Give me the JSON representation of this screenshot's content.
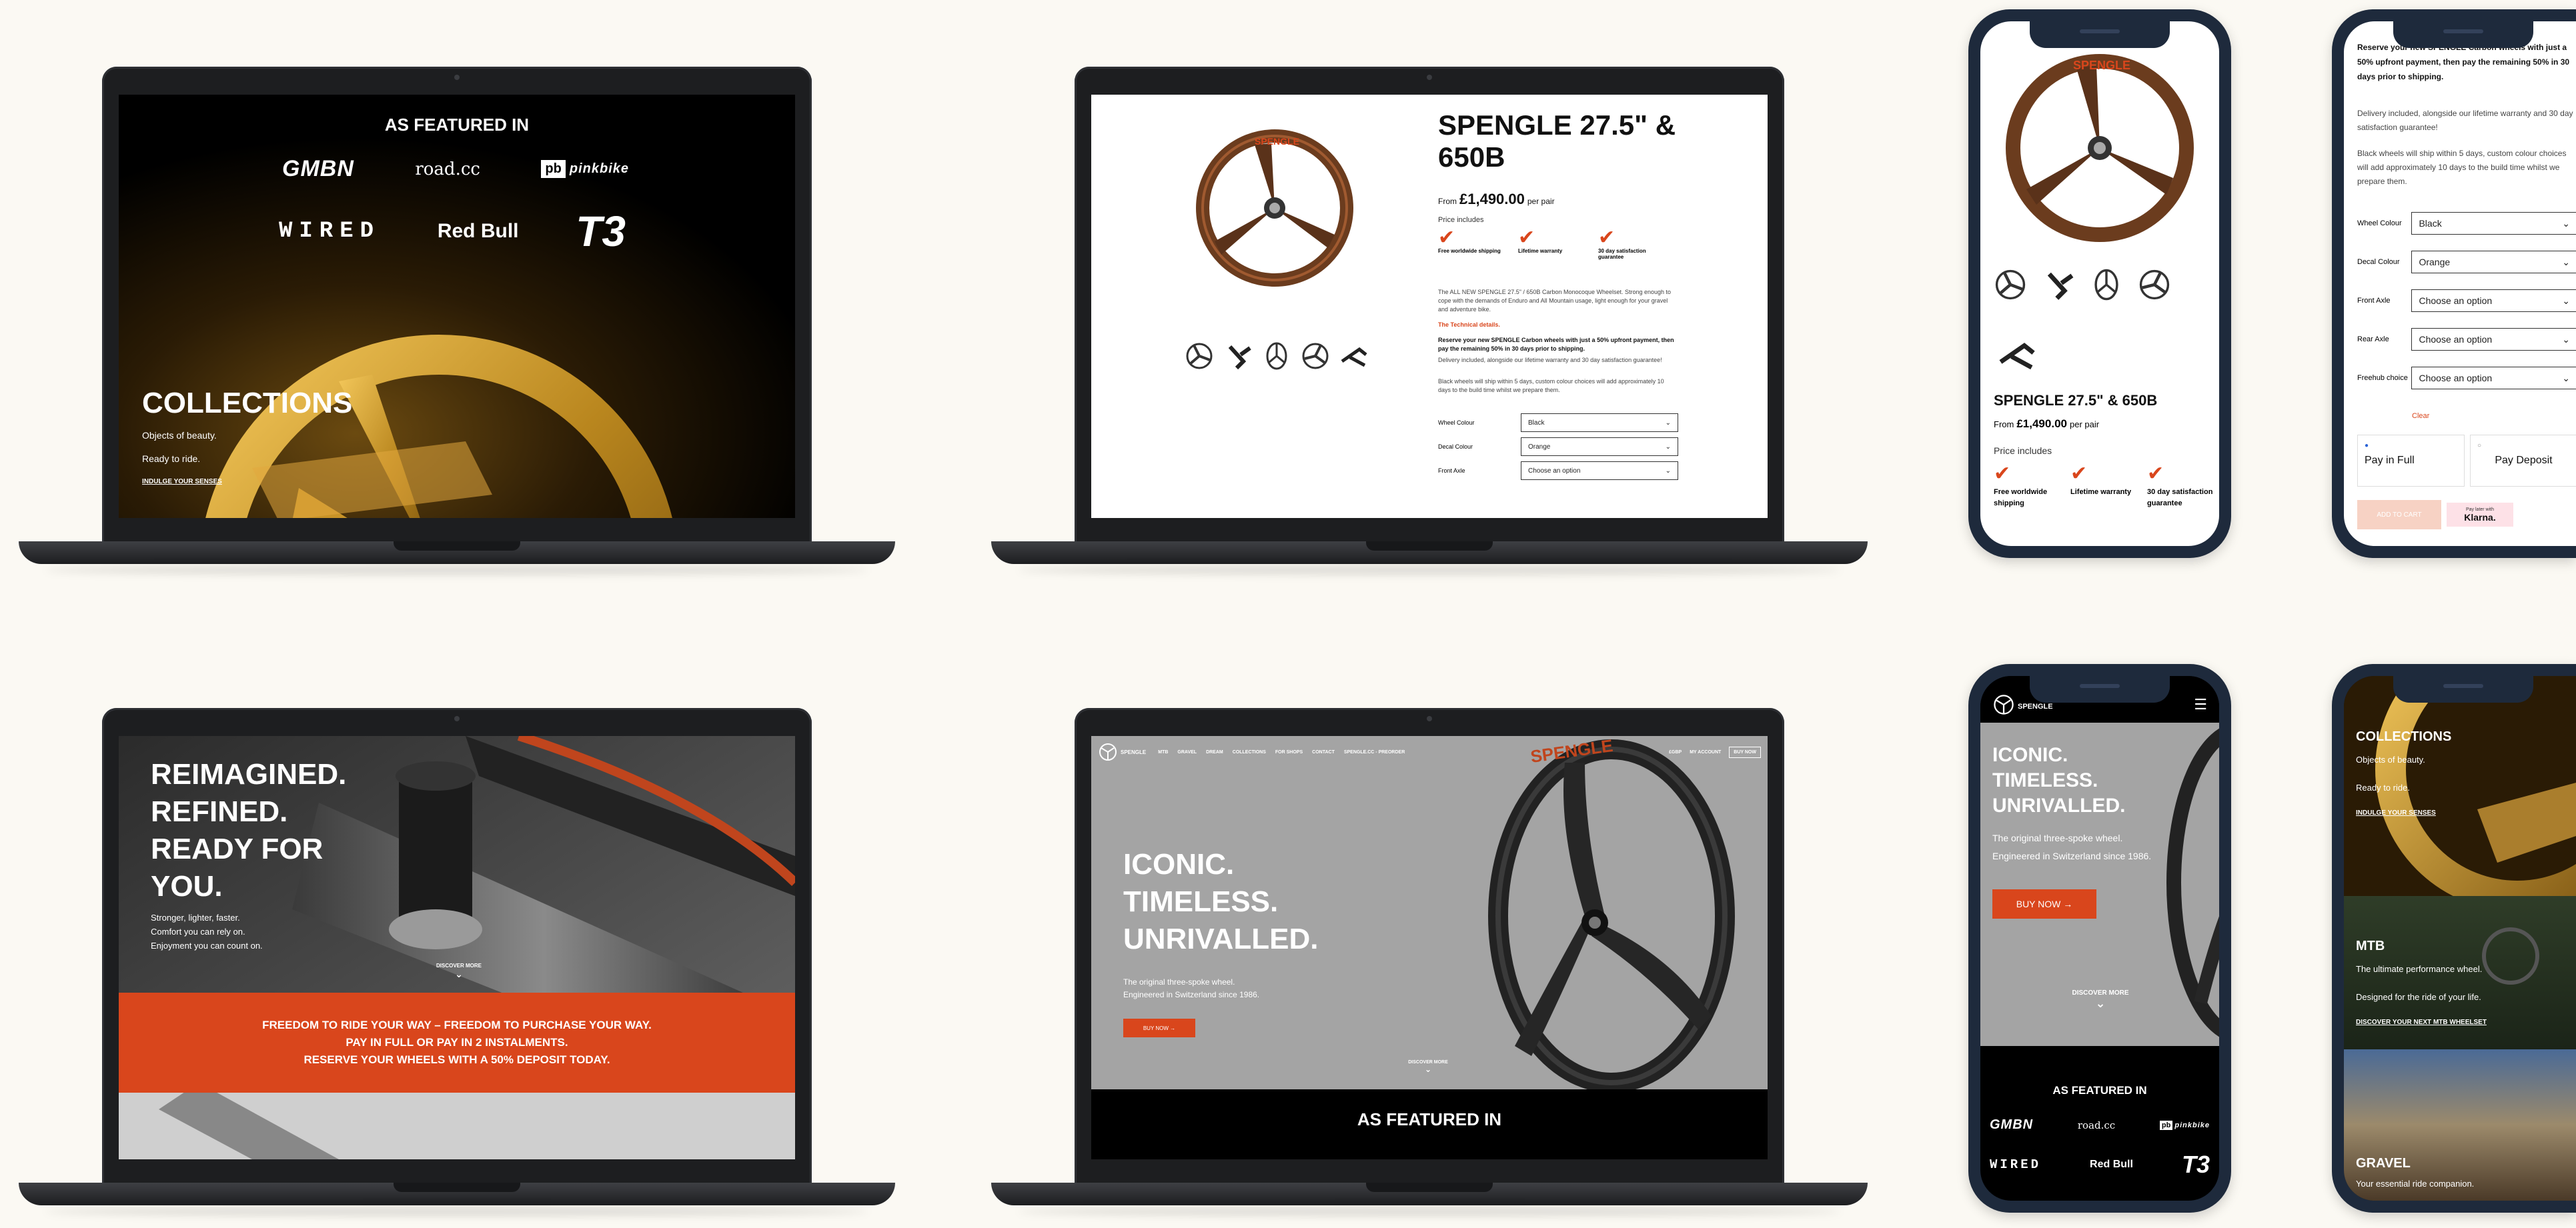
{
  "brand": "SPENGLE",
  "accent_color": "#d9461c",
  "featured": {
    "heading": "AS FEATURED IN",
    "logos": [
      "GMBN",
      "road.cc",
      "pinkbike",
      "WIRED",
      "Red Bull",
      "T3"
    ]
  },
  "collections": {
    "title": "COLLECTIONS",
    "line1": "Objects of beauty.",
    "line2": "Ready to ride.",
    "cta": "INDULGE YOUR SENSES"
  },
  "product": {
    "title": "SPENGLE 27.5\" & 650B",
    "title_mobile": "SPENGLE 27.5\" & 650B",
    "price_from": "From",
    "price": "£1,490.00",
    "price_suffix": "per pair",
    "price_includes": "Price includes",
    "features": [
      "Free worldwide shipping",
      "Lifetime warranty",
      "30 day satisfaction guarantee"
    ],
    "description": "The ALL NEW SPENGLE 27.5\" / 650B Carbon Monocoque Wheelset. Strong enough to cope with the demands of Enduro and All Mountain usage, light enough for your gravel and adventure bike.",
    "technical_link": "The Technical details.",
    "reserve_text": "Reserve your new SPENGLE Carbon wheels with just a 50% upfront payment, then pay the remaining 50% in 30 days prior to shipping.",
    "delivery_text": "Delivery included, alongside our lifetime warranty and 30 day satisfaction guarantee!",
    "black_text": "Black wheels will ship within 5 days, custom colour choices will add approximately 10 days to the build time whilst we prepare them.",
    "options": [
      {
        "label": "Wheel Colour",
        "value": "Black"
      },
      {
        "label": "Decal Colour",
        "value": "Orange"
      },
      {
        "label": "Front Axle",
        "value": "Choose an option"
      },
      {
        "label": "Rear Axle",
        "value": "Choose an option"
      },
      {
        "label": "Freehub choice",
        "value": "Choose an option"
      }
    ],
    "clear": "Clear",
    "pay_full": "Pay in Full",
    "pay_deposit": "Pay Deposit",
    "add_to_cart": "ADD TO CART",
    "klarna_label": "Pay later with",
    "klarna": "Klarna."
  },
  "promo": {
    "headline1": "REIMAGINED.",
    "headline2": "REFINED.",
    "headline3": "READY FOR",
    "headline4": "YOU.",
    "sub1": "Stronger, lighter, faster.",
    "sub2": "Comfort you can rely on.",
    "sub3": "Enjoyment you can count on.",
    "discover": "DISCOVER MORE",
    "banner1": "FREEDOM TO RIDE YOUR WAY – FREEDOM TO PURCHASE YOUR WAY.",
    "banner2": "PAY IN FULL OR PAY IN 2 INSTALMENTS.",
    "banner3": "RESERVE YOUR WHEELS WITH A 50% DEPOSIT TODAY."
  },
  "home": {
    "nav": [
      "MTB",
      "GRAVEL",
      "DREAM",
      "COLLECTIONS",
      "FOR SHOPS",
      "CONTACT",
      "SPENGLE.CC - PREORDER"
    ],
    "nav_right": [
      "£GBP",
      "MY ACCOUNT"
    ],
    "cart": "BUY NOW",
    "headline1": "ICONIC.",
    "headline2": "TIMELESS.",
    "headline3": "UNRIVALLED.",
    "sub1": "The original three-spoke wheel.",
    "sub2": "Engineered in Switzerland since 1986.",
    "cta": "BUY NOW →",
    "discover": "DISCOVER MORE"
  },
  "mobile_home": {
    "brand": "SPENGLE",
    "cta": "BUY NOW →"
  },
  "mobile_collections": {
    "title": "COLLECTIONS",
    "line1": "Objects of beauty.",
    "line2": "Ready to ride.",
    "cta": "INDULGE YOUR SENSES",
    "mtb_title": "MTB",
    "mtb_line1": "The ultimate performance wheel.",
    "mtb_line2": "Designed for the ride of your life.",
    "mtb_cta": "DISCOVER YOUR NEXT MTB WHEELSET",
    "gravel_title": "GRAVEL",
    "gravel_line1": "Your essential ride companion."
  }
}
